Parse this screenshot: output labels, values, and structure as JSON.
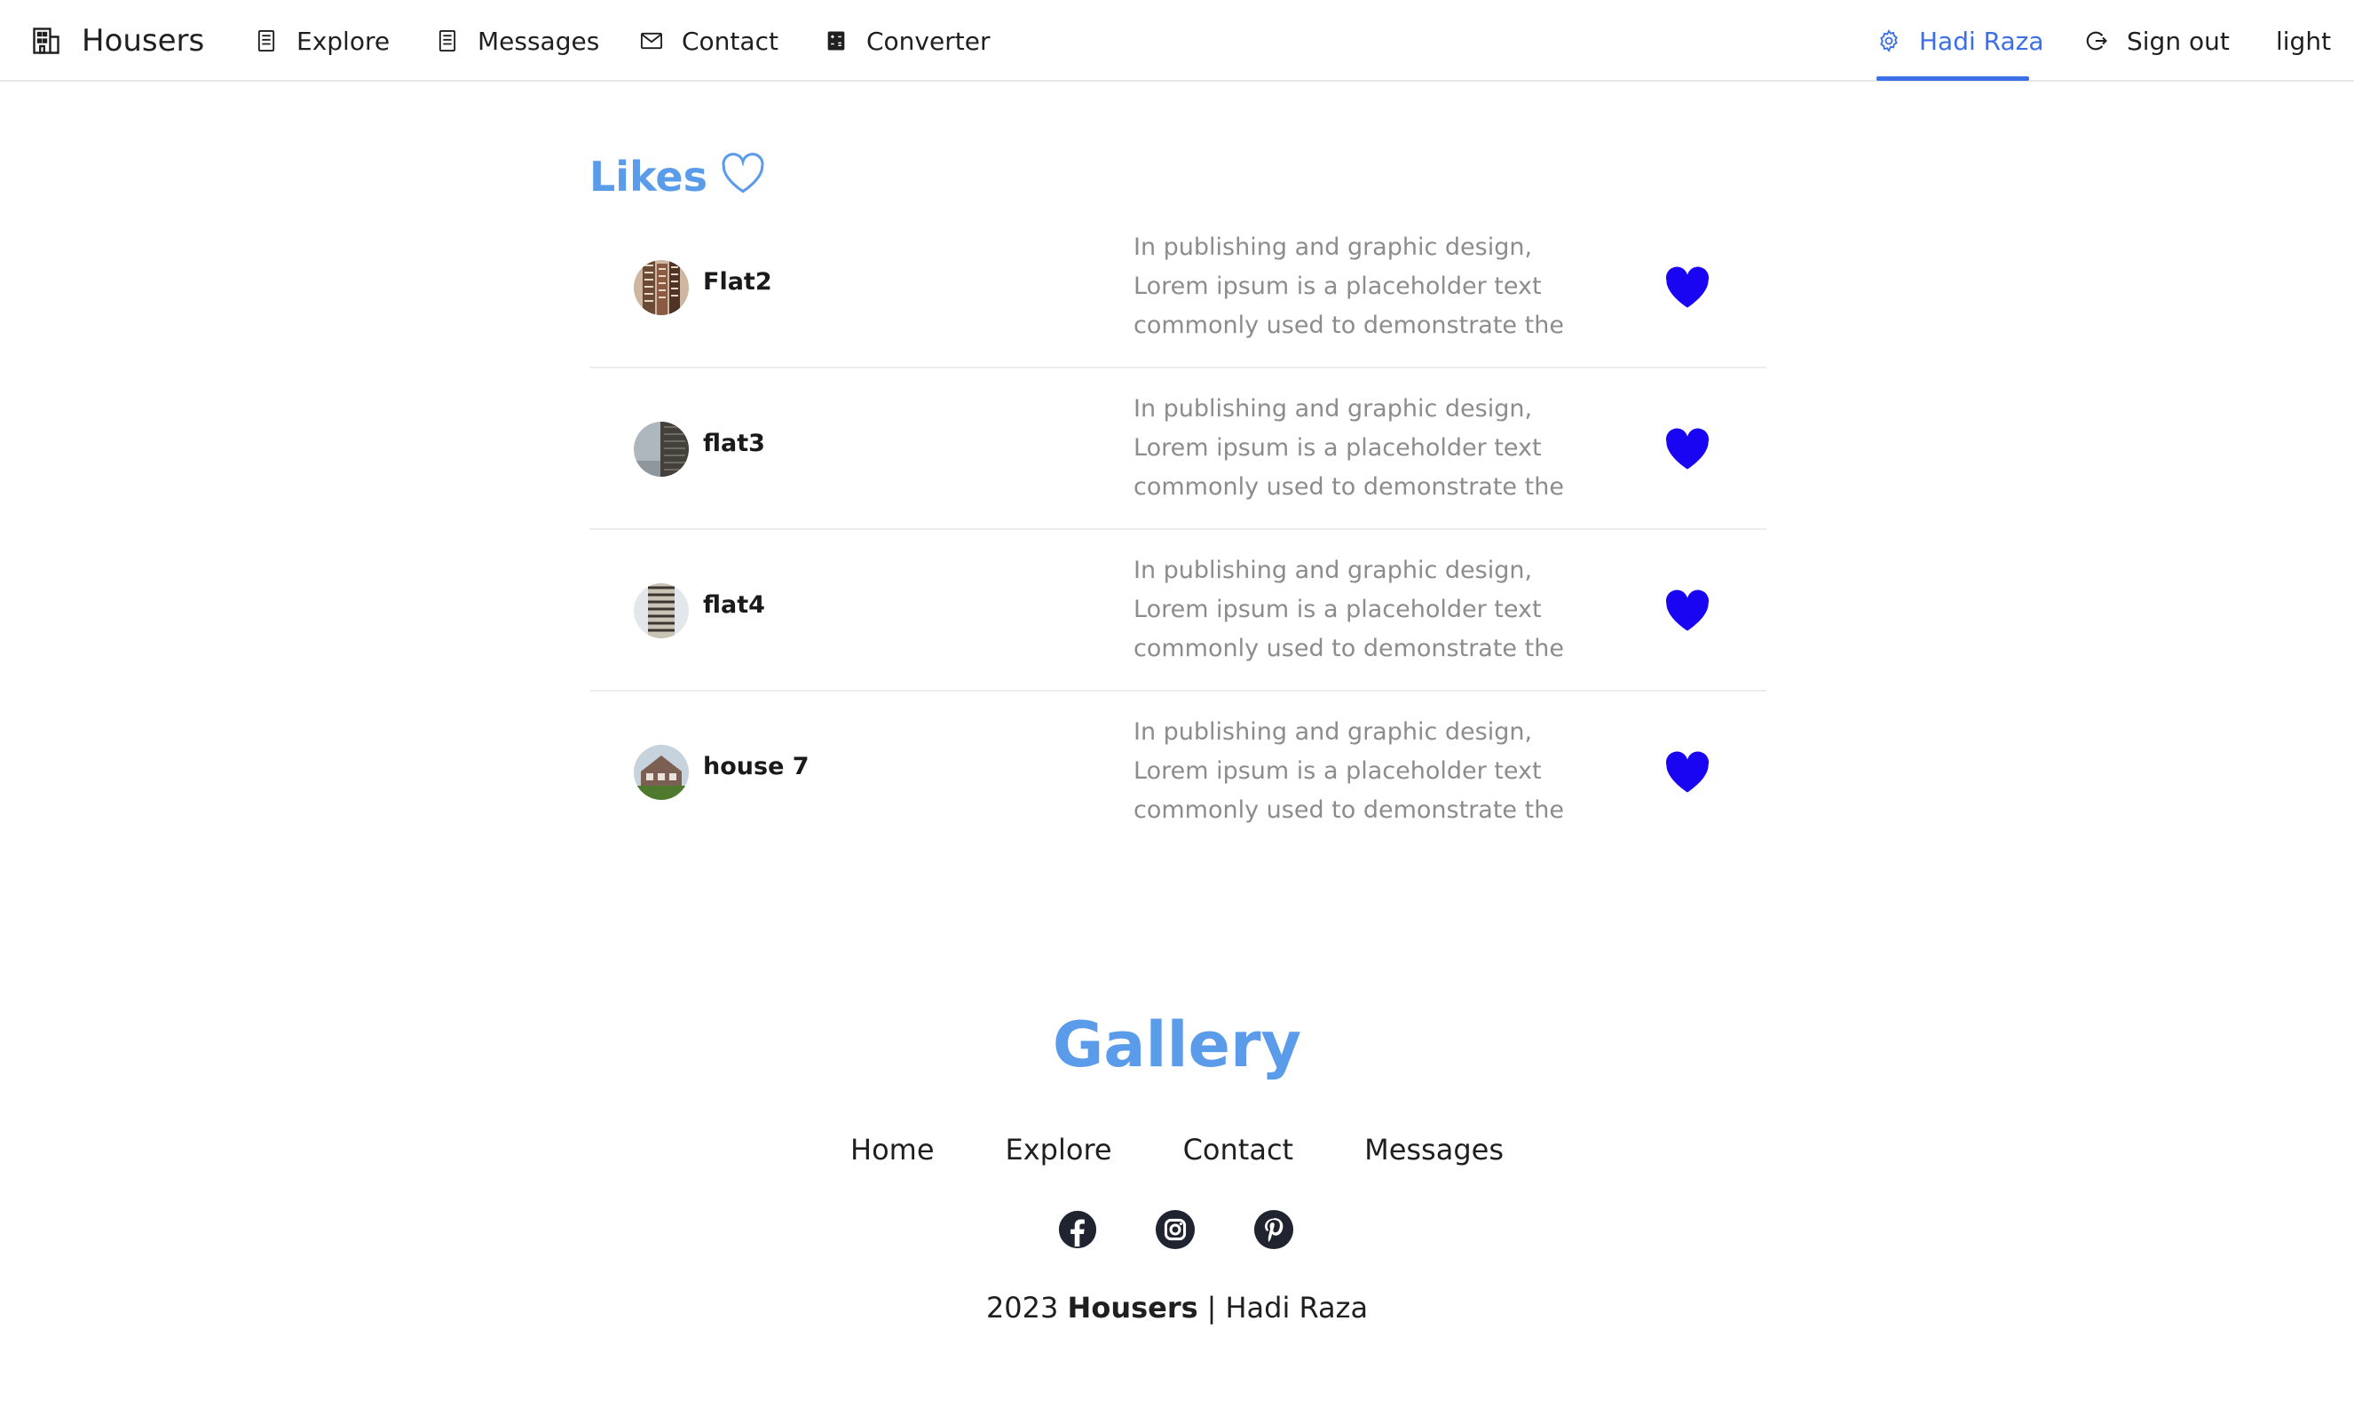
{
  "nav": {
    "brand": "Housers",
    "explore": "Explore",
    "messages": "Messages",
    "contact": "Contact",
    "converter": "Converter",
    "user": "Hadi Raza",
    "signout": "Sign out",
    "theme": "light"
  },
  "likes": {
    "title": "Likes",
    "items": [
      {
        "name": "Flat2",
        "description": "In publishing and graphic design, Lorem ipsum is a placeholder text commonly used to demonstrate the"
      },
      {
        "name": "flat3",
        "description": "In publishing and graphic design, Lorem ipsum is a placeholder text commonly used to demonstrate the"
      },
      {
        "name": "flat4",
        "description": "In publishing and graphic design, Lorem ipsum is a placeholder text commonly used to demonstrate the"
      },
      {
        "name": "house 7",
        "description": "In publishing and graphic design, Lorem ipsum is a placeholder text commonly used to demonstrate the"
      }
    ]
  },
  "footer": {
    "title": "Gallery",
    "links": [
      "Home",
      "Explore",
      "Contact",
      "Messages"
    ],
    "social": [
      "facebook-icon",
      "instagram-icon",
      "pinterest-icon"
    ],
    "year": "2023",
    "brand": "Housers",
    "separator": "|",
    "author": "Hadi Raza"
  },
  "colors": {
    "accent": "#3b6fe8",
    "title": "#5a9bea",
    "heart": "#1a05f2",
    "muted_text": "#8c8c8c"
  }
}
